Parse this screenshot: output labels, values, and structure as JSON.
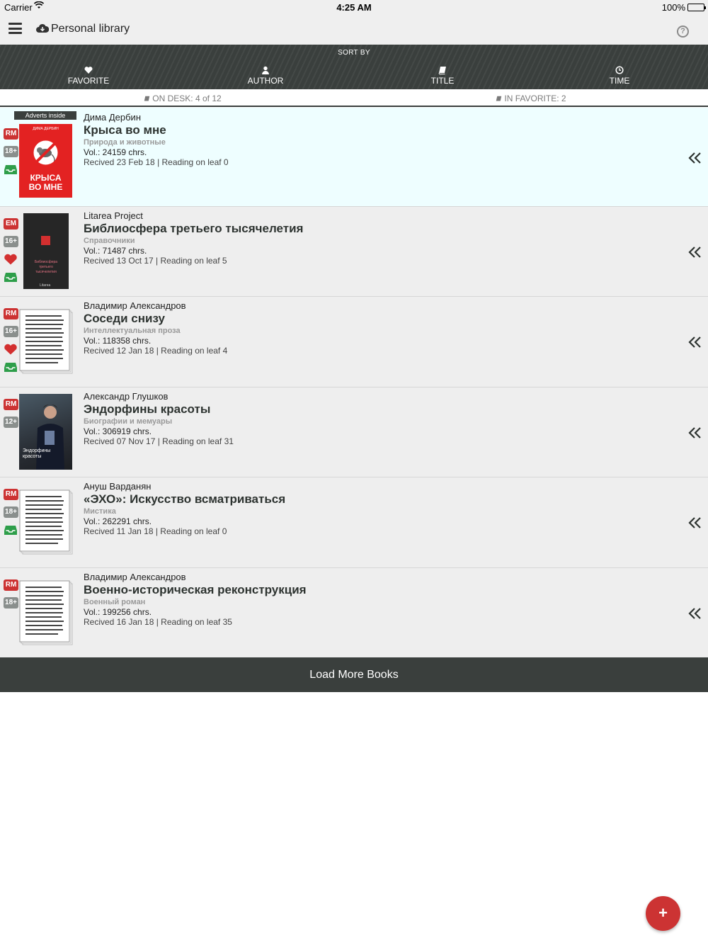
{
  "status_bar": {
    "carrier": "Carrier",
    "time": "4:25 AM",
    "battery": "100%"
  },
  "nav": {
    "title": "Personal library"
  },
  "sort": {
    "label": "SORT BY",
    "options": [
      "FAVORITE",
      "AUTHOR",
      "TITLE",
      "TIME"
    ]
  },
  "info": {
    "on_desk": "ON DESK: 4 of 12",
    "in_favorite": "IN FAVORITE: 2"
  },
  "adverts_label": "Adverts inside",
  "cover_texts": {
    "book0_top": "ДИМА ДЕРБИН",
    "book0_bottom": "КРЫСА ВО МНЕ",
    "book1_text": "Библиосфера третьего тысячелетия",
    "book1_brand": "Litarea",
    "book3_text": "Эндорфины красоты"
  },
  "books": [
    {
      "author": "Дима Дербин",
      "title": "Крыса во мне",
      "genre": "Природа и животные",
      "vol": "Vol.:  24159 chrs.",
      "received": "Recived 23 Feb 18 | Reading on leaf 0",
      "badge": "RM",
      "age": "18+",
      "favorite": false,
      "on_desk": true
    },
    {
      "author": "Litarea Project",
      "title": "Библиосфера третьего тысячелетия",
      "genre": "Справочники",
      "vol": "Vol.:  71487 chrs.",
      "received": "Recived 13 Oct 17 | Reading on leaf 5",
      "badge": "EM",
      "age": "16+",
      "favorite": true,
      "on_desk": true
    },
    {
      "author": "Владимир Александров",
      "title": "Соседи снизу",
      "genre": "Интеллектуальная проза",
      "vol": "Vol.:  118358 chrs.",
      "received": "Recived 12 Jan 18 | Reading on leaf 4",
      "badge": "RM",
      "age": "16+",
      "favorite": true,
      "on_desk": true
    },
    {
      "author": "Александр Глушков",
      "title": "Эндорфины красоты",
      "genre": "Биографии и мемуары",
      "vol": "Vol.:  306919 chrs.",
      "received": "Recived 07 Nov 17 | Reading on leaf 31",
      "badge": "RM",
      "age": "12+",
      "favorite": false,
      "on_desk": false
    },
    {
      "author": "Ануш Варданян",
      "title": "«ЭХО»: Искусство всматриваться",
      "genre": "Мистика",
      "vol": "Vol.:  262291 chrs.",
      "received": "Recived 11 Jan 18 | Reading on leaf 0",
      "badge": "RM",
      "age": "18+",
      "favorite": false,
      "on_desk": true
    },
    {
      "author": "Владимир Александров",
      "title": "Военно-историческая реконструкция",
      "genre": "Военный роман",
      "vol": "Vol.:  199256 chrs.",
      "received": "Recived 16 Jan 18 | Reading on leaf 35",
      "badge": "RM",
      "age": "18+",
      "favorite": false,
      "on_desk": false
    }
  ],
  "load_more": "Load More Books",
  "fab": "+",
  "colors": {
    "accent_red": "#cc3333",
    "dark_bar": "#3a3f3d",
    "desk_green": "#2e9e4a",
    "highlight": "#eefeff"
  },
  "icons": [
    "menu-icon",
    "cloud-download-icon",
    "help-icon",
    "heart-icon",
    "user-icon",
    "book-icon",
    "clock-icon",
    "inbox-icon",
    "chevron-double-left-icon",
    "plus-icon"
  ]
}
